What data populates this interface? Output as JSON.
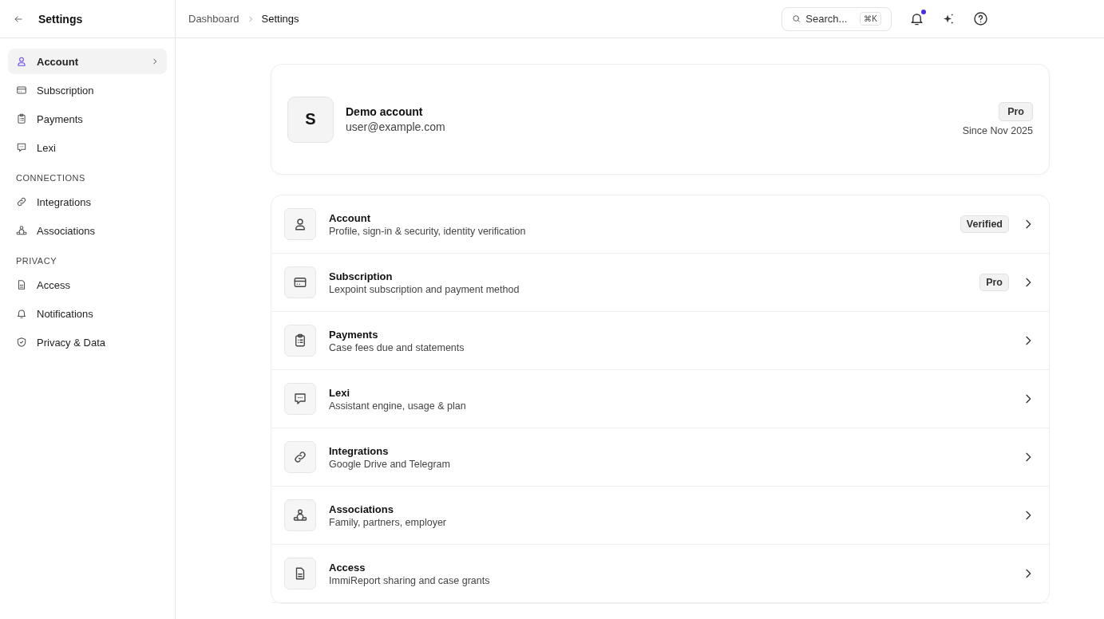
{
  "sidebar": {
    "title": "Settings",
    "sections": [
      {
        "items": [
          {
            "label": "Account",
            "kind": "user",
            "selected": true
          },
          {
            "label": "Subscription",
            "kind": "card",
            "selected": false
          },
          {
            "label": "Payments",
            "kind": "clipboard",
            "selected": false
          },
          {
            "label": "Lexi",
            "kind": "chat",
            "selected": false
          }
        ]
      },
      {
        "heading": "CONNECTIONS",
        "items": [
          {
            "label": "Integrations",
            "kind": "link",
            "selected": false
          },
          {
            "label": "Associations",
            "kind": "people",
            "selected": false
          }
        ]
      },
      {
        "heading": "PRIVACY",
        "items": [
          {
            "label": "Access",
            "kind": "file",
            "selected": false
          },
          {
            "label": "Notifications",
            "kind": "bell",
            "selected": false
          },
          {
            "label": "Privacy & Data",
            "kind": "shield",
            "selected": false
          }
        ]
      }
    ]
  },
  "header": {
    "breadcrumbs": [
      "Dashboard",
      "Settings"
    ],
    "search": {
      "placeholder": "Search...",
      "shortcut": "⌘K"
    },
    "notifications_unread": true
  },
  "profile": {
    "initial": "S",
    "name": "Demo account",
    "email": "user@example.com",
    "plan": "Pro",
    "since": "Since Nov 2025"
  },
  "settings_rows": [
    {
      "title": "Account",
      "description": "Profile, sign-in & security, identity verification",
      "kind": "user",
      "badge": "Verified"
    },
    {
      "title": "Subscription",
      "description": "Lexpoint subscription and payment method",
      "kind": "card",
      "badge": "Pro"
    },
    {
      "title": "Payments",
      "description": "Case fees due and statements",
      "kind": "clipboard"
    },
    {
      "title": "Lexi",
      "description": "Assistant engine, usage & plan",
      "kind": "chat"
    },
    {
      "title": "Integrations",
      "description": "Google Drive and Telegram",
      "kind": "link"
    },
    {
      "title": "Associations",
      "description": "Family, partners, employer",
      "kind": "people"
    },
    {
      "title": "Access",
      "description": "ImmiReport sharing and case grants",
      "kind": "file"
    }
  ]
}
